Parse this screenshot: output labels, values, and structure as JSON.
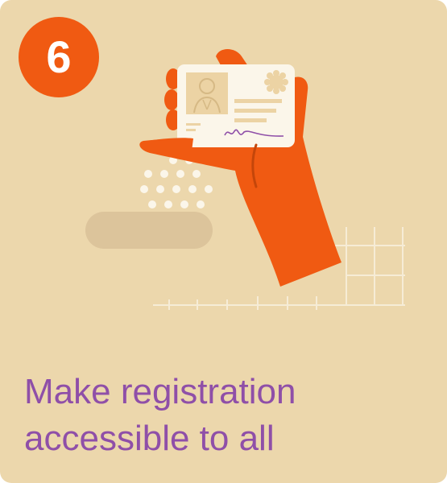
{
  "step_badge": {
    "number": "6"
  },
  "headline": {
    "line1": "Make registration",
    "line2": "accessible to all"
  },
  "colors": {
    "background": "#ecd7ac",
    "badge": "#f05a12",
    "hand": "#f05a12",
    "headline_text": "#8f4fa8",
    "id_card": "#fbf6ea",
    "card_detail": "#ecd3a4",
    "signature": "#8f4fa8"
  },
  "icons": {
    "illustration": "hand-holding-id-card",
    "card_photo": "person-portrait-icon",
    "card_seal": "seal-badge-icon"
  }
}
